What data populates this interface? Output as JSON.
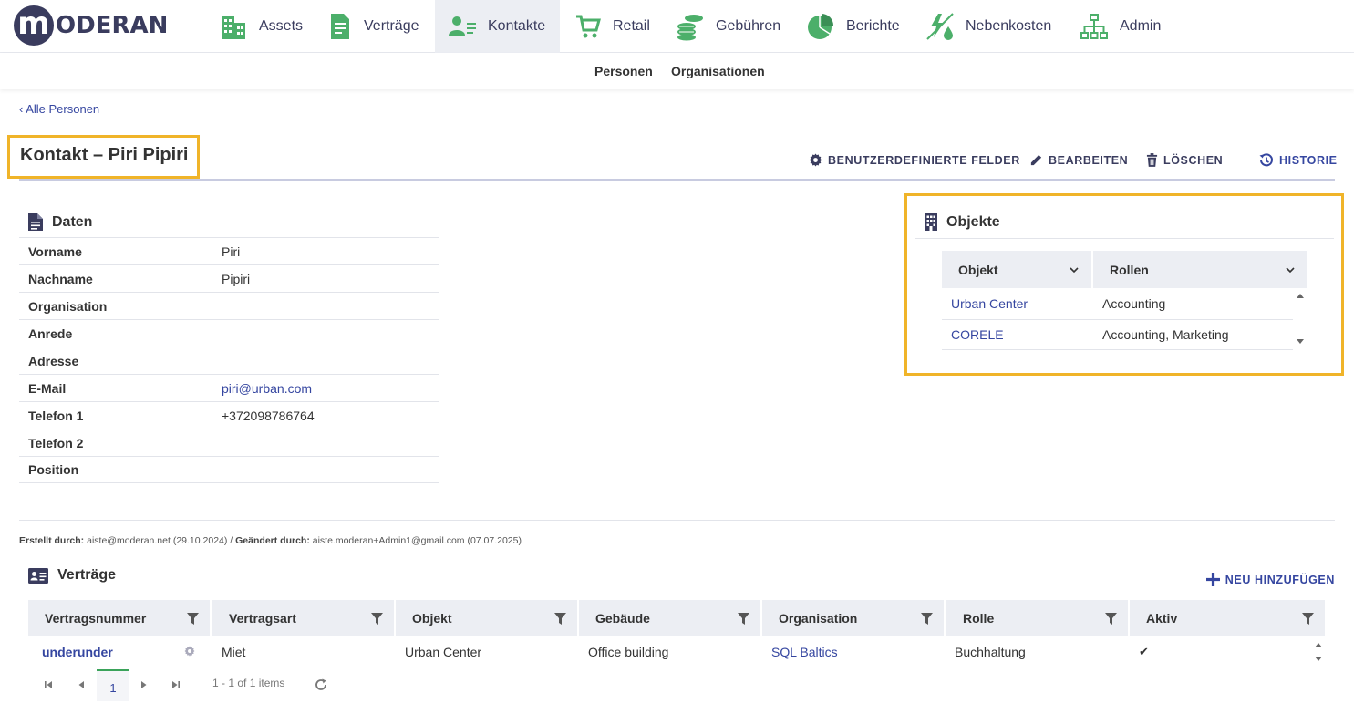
{
  "brand": {
    "logo_letter": "m",
    "logo_text": "ODERAN"
  },
  "nav": {
    "items": [
      {
        "label": "Assets",
        "icon": "building-icon"
      },
      {
        "label": "Verträge",
        "icon": "document-icon"
      },
      {
        "label": "Kontakte",
        "icon": "contact-card-icon",
        "active": true
      },
      {
        "label": "Retail",
        "icon": "cart-icon"
      },
      {
        "label": "Gebühren",
        "icon": "coins-icon"
      },
      {
        "label": "Berichte",
        "icon": "pie-chart-icon"
      },
      {
        "label": "Nebenkosten",
        "icon": "utilities-icon"
      },
      {
        "label": "Admin",
        "icon": "hierarchy-icon"
      }
    ]
  },
  "subnav": {
    "items": [
      "Personen",
      "Organisationen"
    ]
  },
  "back_link": "‹ Alle Personen",
  "page_title": "Kontakt – Piri Pipiri",
  "actions": {
    "custom_fields": "BENUTZERDEFINIERTE FELDER",
    "edit": "BEARBEITEN",
    "delete": "LÖSCHEN",
    "history": "HISTORIE"
  },
  "daten": {
    "title": "Daten",
    "rows": [
      {
        "label": "Vorname",
        "value": "Piri"
      },
      {
        "label": "Nachname",
        "value": "Pipiri"
      },
      {
        "label": "Organisation",
        "value": ""
      },
      {
        "label": "Anrede",
        "value": ""
      },
      {
        "label": "Adresse",
        "value": ""
      },
      {
        "label": "E-Mail",
        "value": "piri@urban.com",
        "link": true
      },
      {
        "label": "Telefon 1",
        "value": "+372098786764"
      },
      {
        "label": "Telefon 2",
        "value": ""
      },
      {
        "label": "Position",
        "value": ""
      }
    ]
  },
  "objekte": {
    "title": "Objekte",
    "columns": [
      "Objekt",
      "Rollen"
    ],
    "rows": [
      {
        "objekt": "Urban Center",
        "rollen": "Accounting"
      },
      {
        "objekt": "CORELE",
        "rollen": "Accounting, Marketing"
      }
    ]
  },
  "meta": {
    "created_label": "Erstellt durch:",
    "created_value": "aiste@moderan.net (29.10.2024)",
    "separator": " / ",
    "changed_label": "Geändert durch:",
    "changed_value": "aiste.moderan+Admin1@gmail.com (07.07.2025)"
  },
  "vertraege": {
    "title": "Verträge",
    "add_label": "NEU HINZUFÜGEN",
    "columns": [
      "Vertragsnummer",
      "Vertragsart",
      "Objekt",
      "Gebäude",
      "Organisation",
      "Rolle",
      "Aktiv"
    ],
    "rows": [
      {
        "vertragsnummer": "underunder",
        "vertragsart": "Miet",
        "objekt": "Urban Center",
        "gebaeude": "Office building",
        "organisation": "SQL Baltics",
        "rolle": "Buchhaltung",
        "aktiv": "✔"
      }
    ]
  },
  "pager": {
    "current_page": "1",
    "summary": "1 - 1 of 1 items"
  },
  "colors": {
    "accent": "#3546a0",
    "brand": "#3a3c5e",
    "icon_green": "#4caf6a",
    "highlight": "#f0b429"
  }
}
